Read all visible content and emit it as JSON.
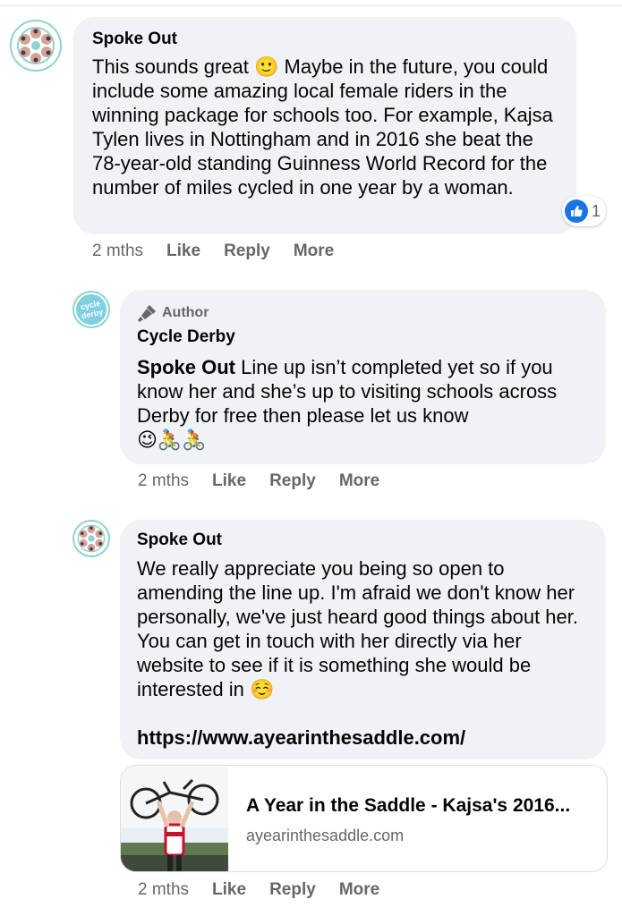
{
  "comments": [
    {
      "author": "Spoke Out",
      "text": "This sounds great 🙂 Maybe in the future, you could include some amazing local female riders in the winning package for schools too. For example, Kajsa Tylen lives in Nottingham and in 2016 she beat the 78-year-old standing Guinness World Record for the number of miles cycled in one year by a woman.",
      "reaction_count": "1",
      "time": "2 mths",
      "actions": [
        "Like",
        "Reply",
        "More"
      ]
    },
    {
      "badge": "Author",
      "author": "Cycle Derby",
      "mention": "Spoke Out",
      "text": " Line up isn’t completed yet so if you know her and she’s up to visiting schools across Derby for free then please let us know",
      "emojis": "😉🚴🚴",
      "avatar_text": "cycle derby",
      "time": "2 mths",
      "actions": [
        "Like",
        "Reply",
        "More"
      ]
    },
    {
      "author": "Spoke Out",
      "text": "We really appreciate you being so open to amending the line up. I'm afraid we don't know her personally, we've just heard good things about her. You can get in touch with her directly via her website to see if it is something she would be interested in ☺️",
      "link": "https://www.ayearinthesaddle.com/",
      "link_card": {
        "title": "A Year in the Saddle - Kajsa's 2016...",
        "domain": "ayearinthesaddle.com"
      },
      "time": "2 mths",
      "actions": [
        "Like",
        "Reply",
        "More"
      ]
    }
  ],
  "colors": {
    "bubble": "#f0f2f5",
    "meta": "#65676b",
    "like_blue": "#1b74e4",
    "avatar_ring": "#8fd3cf"
  }
}
